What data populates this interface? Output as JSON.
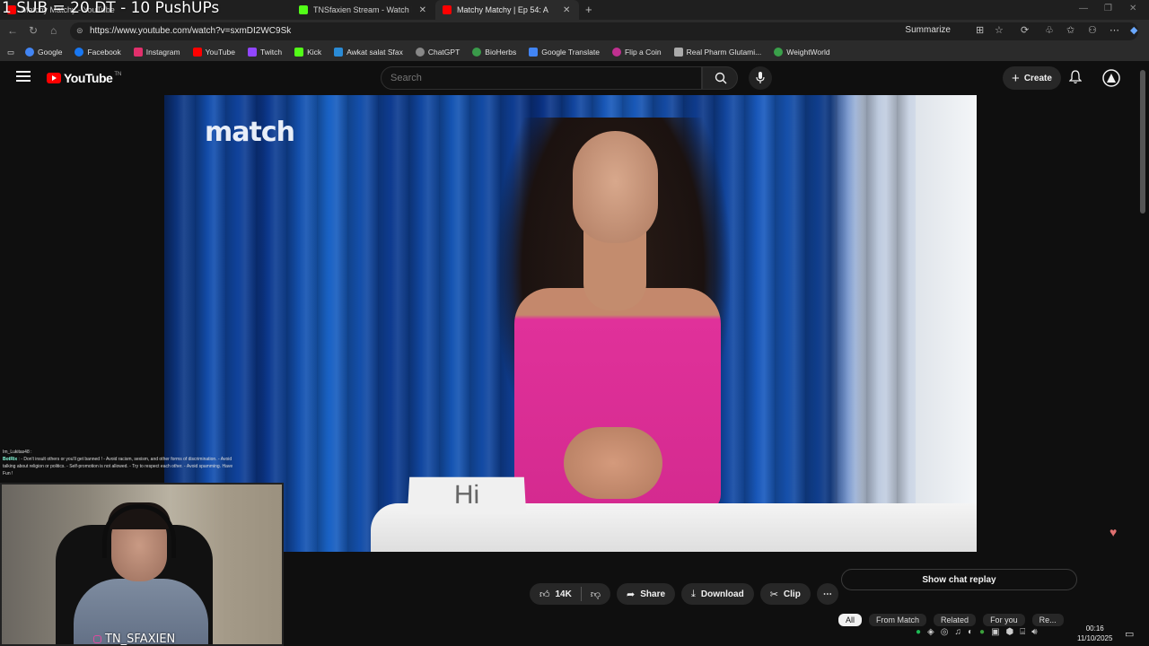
{
  "overlay": {
    "stream_text": "1 SUB = 20 DT - 10 PushUPs"
  },
  "tabs": [
    {
      "label": "Matchy Matchy - YouTube",
      "icon_color": "#ff0000"
    },
    {
      "label": "TNSfaxien Stream - Watch Live on Kick",
      "icon_color": "#53fc18"
    },
    {
      "label": "Matchy Matchy | Ep 54: A",
      "icon_color": "#ff0000"
    }
  ],
  "address": {
    "url": "https://www.youtube.com/watch?v=sxmDI2WC9Sk",
    "summarize": "Summarize"
  },
  "bookmarks": [
    {
      "label": "Google",
      "color": "#4285f4"
    },
    {
      "label": "Facebook",
      "color": "#1877f2"
    },
    {
      "label": "Instagram",
      "color": "#e1306c"
    },
    {
      "label": "YouTube",
      "color": "#ff0000"
    },
    {
      "label": "Twitch",
      "color": "#9146ff"
    },
    {
      "label": "Kick",
      "color": "#53fc18"
    },
    {
      "label": "Awkat salat Sfax",
      "color": "#2a8bd6"
    },
    {
      "label": "ChatGPT",
      "color": "#888888"
    },
    {
      "label": "BioHerbs",
      "color": "#3a9a4a"
    },
    {
      "label": "Google Translate",
      "color": "#4285f4"
    },
    {
      "label": "Flip a Coin",
      "color": "#c03090"
    },
    {
      "label": "Real Pharm Glutami...",
      "color": "#aaaaaa"
    },
    {
      "label": "WeightWorld",
      "color": "#3aa04a"
    }
  ],
  "youtube": {
    "logo": "YouTube",
    "country": "TN",
    "search_placeholder": "Search",
    "create_label": "Create",
    "brand_red": "#ff0000"
  },
  "video": {
    "watermark": "match",
    "card_text": "Hi"
  },
  "stream_chat": {
    "user": "Im_Lukitas48 :",
    "bot_name": "BotRix",
    "bot_message": ": - Don't insult others or you'll get banned ! - Avoid racism, sexism, and other forms of discrimination. - Avoid talking about religion or politics. - Self-promotion is not allowed. - Try to respect each other. - Avoid spamming. Have Fun !"
  },
  "webcam": {
    "name": "TN_SFAXIEN"
  },
  "actions": {
    "likes": "14K",
    "share": "Share",
    "download": "Download",
    "clip": "Clip"
  },
  "chat_replay_label": "Show chat replay",
  "chips": [
    "All",
    "From Match",
    "Related",
    "For you",
    "Re..."
  ],
  "clock": {
    "time": "00:16",
    "date": "11/10/2025"
  }
}
